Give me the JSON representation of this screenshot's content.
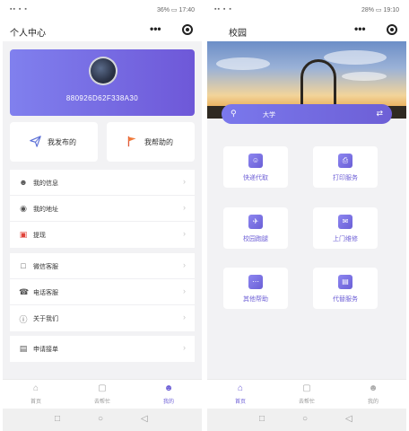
{
  "left": {
    "status": {
      "left": "▪▪ ▪ ▪",
      "right": "36% ▭ 17:40"
    },
    "title": "个人中心",
    "capsule": {
      "more": "•••"
    },
    "profile": {
      "uid": "880926D62F338A30"
    },
    "actions": [
      {
        "icon": "paper-plane-icon",
        "label": "我发布的"
      },
      {
        "icon": "flag-icon",
        "label": "我帮助的"
      }
    ],
    "group1": [
      {
        "icon": "user-icon",
        "label": "我的信息"
      },
      {
        "icon": "location-icon",
        "label": "我的地址"
      },
      {
        "icon": "wallet-icon",
        "label": "提现"
      }
    ],
    "group2": [
      {
        "icon": "chat-icon",
        "label": "微信客服"
      },
      {
        "icon": "phone-icon",
        "label": "电话客服"
      },
      {
        "icon": "info-icon",
        "label": "关于我们"
      }
    ],
    "group3": [
      {
        "icon": "apply-icon",
        "label": "申请接单"
      }
    ],
    "tabs": [
      {
        "label": "首页"
      },
      {
        "label": "去帮忙"
      },
      {
        "label": "我的"
      }
    ]
  },
  "right": {
    "status": {
      "left": "▪▪ ▪ ▪",
      "right": "28% ▭ 19:10"
    },
    "title": "校园",
    "capsule": {
      "more": "•••"
    },
    "location": "大学",
    "services": [
      {
        "icon": "delivery-icon",
        "label": "快递代取"
      },
      {
        "icon": "printer-icon",
        "label": "打印服务"
      },
      {
        "icon": "running-icon",
        "label": "校园跑腿"
      },
      {
        "icon": "mail-icon",
        "label": "上门维修"
      },
      {
        "icon": "more-icon",
        "label": "其他帮助"
      },
      {
        "icon": "substitute-icon",
        "label": "代替服务"
      }
    ],
    "tabs": [
      {
        "label": "首页"
      },
      {
        "label": "去帮忙"
      },
      {
        "label": "我的"
      }
    ]
  },
  "colors": {
    "accent": "#6d5fd6",
    "gradient_start": "#8080ee",
    "gradient_end": "#6e58d8"
  }
}
